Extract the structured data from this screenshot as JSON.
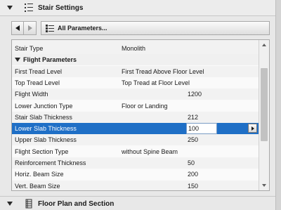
{
  "panel": {
    "title": "Stair Settings"
  },
  "toolbar": {
    "params_label": "All Parameters..."
  },
  "rows": [
    {
      "label": "Stair Type",
      "value": "Monolith",
      "value_col": 1
    },
    {
      "label": "Flight Parameters",
      "section": true
    },
    {
      "label": "First Tread Level",
      "value": "First Tread Above Floor Level",
      "value_col": 1
    },
    {
      "label": "Top Tread Level",
      "value": "Top Tread at Floor Level",
      "value_col": 1
    },
    {
      "label": "Flight Width",
      "value": "1200",
      "value_col": 2
    },
    {
      "label": "Lower Junction Type",
      "value": "Floor or Landing",
      "value_col": 1
    },
    {
      "label": "Stair Slab Thickness",
      "value": "212",
      "value_col": 2
    },
    {
      "label": "Lower Slab Thickness",
      "value": "100",
      "value_col": 2,
      "selected": true
    },
    {
      "label": "Upper Slab Thickness",
      "value": "250",
      "value_col": 2
    },
    {
      "label": "Flight Section Type",
      "value": "without Spine Beam",
      "value_col": 1
    },
    {
      "label": "Reinforcement Thickness",
      "value": "50",
      "value_col": 2
    },
    {
      "label": "Horiz. Beam Size",
      "value": "200",
      "value_col": 2
    },
    {
      "label": "Vert. Beam Size",
      "value": "150",
      "value_col": 2
    }
  ],
  "bottom_panel": {
    "title": "Floor Plan and Section"
  },
  "colors": {
    "selection": "#1f6fc6",
    "background": "#e8e8e8"
  },
  "icons": {
    "header": "stair-settings-icon",
    "params": "list-icon",
    "bottom": "floor-plan-icon"
  }
}
